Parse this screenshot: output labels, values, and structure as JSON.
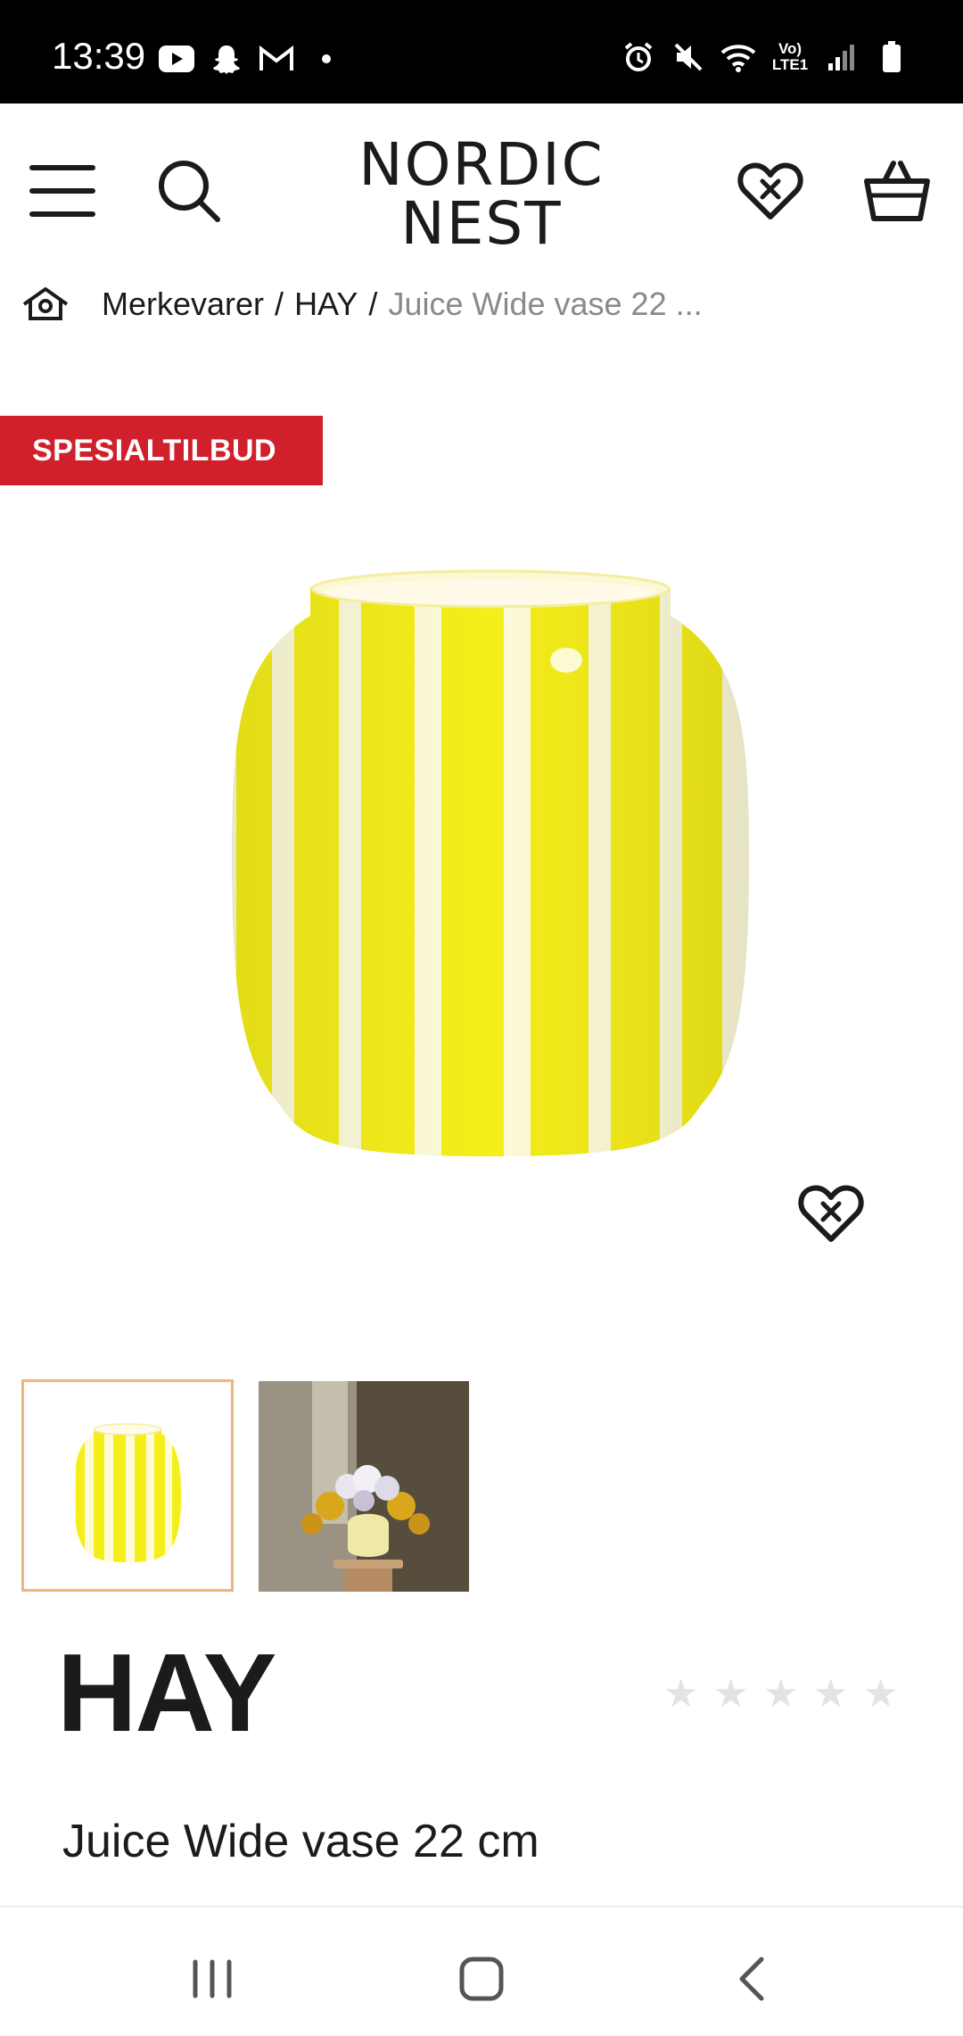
{
  "status_bar": {
    "time": "13:39",
    "network_label_top": "Vo)",
    "network_label_bottom": "LTE1",
    "left_icons": [
      "youtube-icon",
      "snapchat-icon",
      "gmail-icon",
      "dot-icon"
    ],
    "right_icons": [
      "alarm-icon",
      "mute-icon",
      "wifi-icon",
      "volte-icon",
      "signal-icon",
      "battery-icon"
    ]
  },
  "header": {
    "logo_line1": "NORDIC",
    "logo_line2": "NEST",
    "icons": [
      "menu-icon",
      "search-icon",
      "heart-icon",
      "basket-icon"
    ]
  },
  "breadcrumb": {
    "items": [
      "Merkevarer",
      "HAY"
    ],
    "separator": "/",
    "current": "Juice Wide vase 22 ..."
  },
  "badge": {
    "label": "SPESIALTILBUD",
    "color": "#d0202b"
  },
  "product": {
    "brand": "HAY",
    "name": "Juice Wide vase 22 cm",
    "rating_stars": 5,
    "rating_value": 0,
    "star_glyph": "★"
  },
  "thumbnails": {
    "selected_index": 0,
    "count": 2
  },
  "colors": {
    "accent_border": "#f0b57a",
    "vase_yellow": "#f5ee1a",
    "vase_cream": "#fdfbd8",
    "star_empty": "#e3e3e3"
  },
  "nav_bar": {
    "icons": [
      "recent-apps-icon",
      "home-icon",
      "back-icon"
    ]
  }
}
